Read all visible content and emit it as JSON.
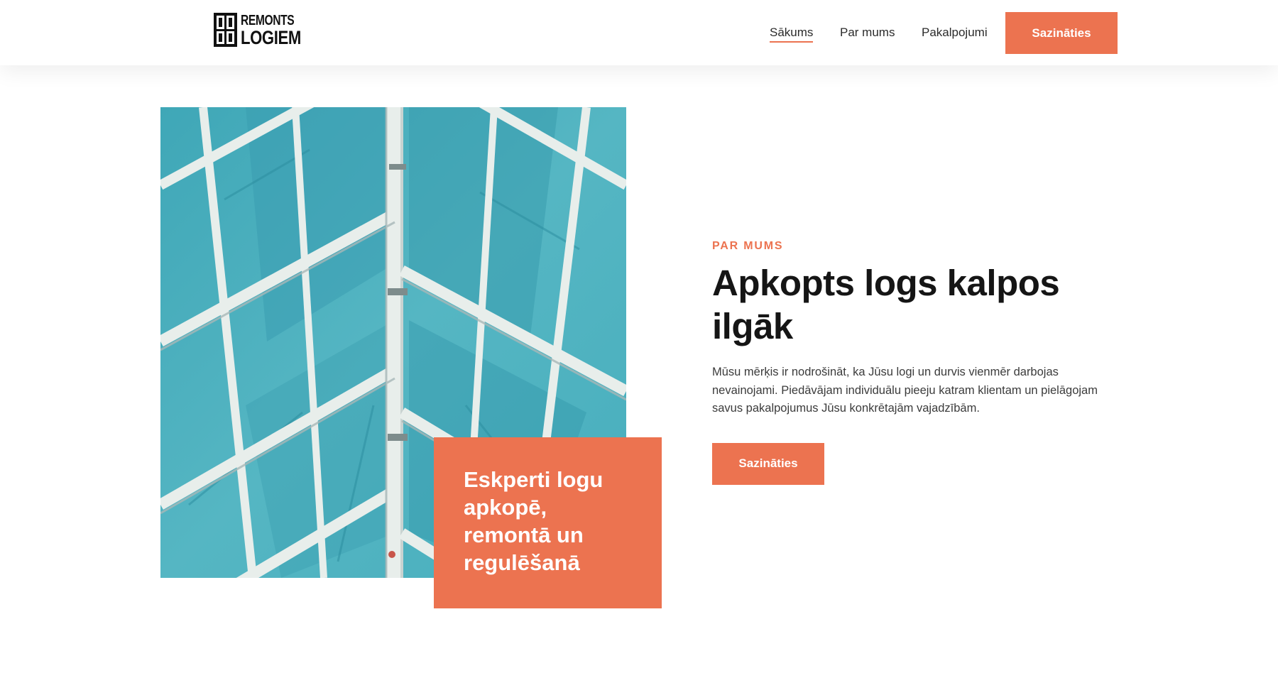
{
  "header": {
    "logo": {
      "line1": "REMONTS",
      "line2": "LOGIEM",
      "icon": "window-logo-icon"
    },
    "nav": [
      {
        "label": "Sākums",
        "active": true
      },
      {
        "label": "Par mums",
        "active": false
      },
      {
        "label": "Pakalpojumi",
        "active": false
      }
    ],
    "cta_label": "Sazināties"
  },
  "hero": {
    "image": "glass-roof-photo",
    "overlay_title": "Eskperti logu apkopē, remontā un regulēšanā"
  },
  "about": {
    "eyebrow": "PAR MUMS",
    "headline": "Apkopts logs kalpos ilgāk",
    "body": "Mūsu mērķis ir nodrošināt, ka Jūsu logi un durvis vienmēr darbojas nevainojami. Piedāvājam individuālu pieeju katram klientam un pielāgojam savus pakalpojumus Jūsu konkrētajām vajadzībām.",
    "cta_label": "Sazināties"
  },
  "colors": {
    "accent": "#ec7350",
    "heading": "#151515",
    "text": "#3b3b3b",
    "photo_glass": "#4db1c0",
    "photo_frame": "#e6ece9"
  }
}
